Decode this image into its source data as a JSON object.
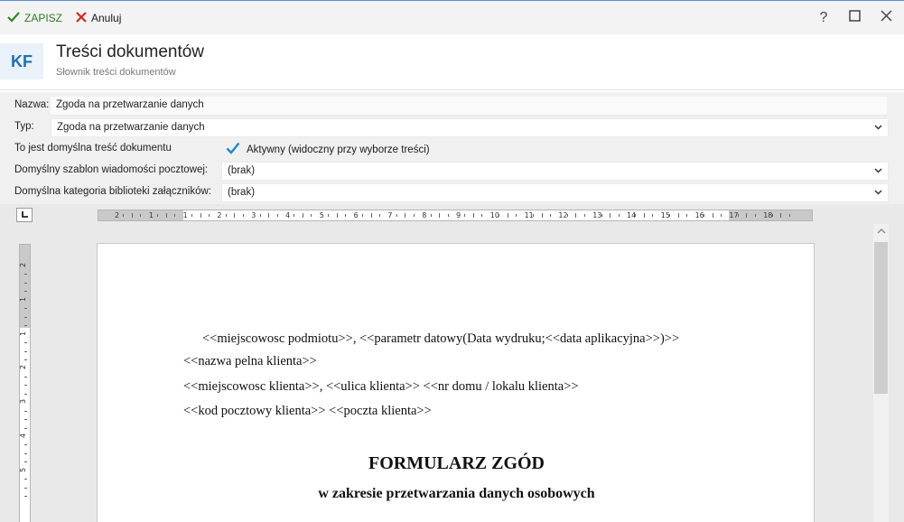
{
  "toolbar": {
    "save_label": "ZAPISZ",
    "cancel_label": "Anuluj",
    "help_label": "?",
    "accent_color": "#2e7d1f"
  },
  "header": {
    "logo": "KF",
    "title": "Treści dokumentów",
    "subtitle": "Słownik treści dokumentów"
  },
  "form": {
    "name_label": "Nazwa:",
    "name_value": "Zgoda na przetwarzanie danych",
    "type_label": "Typ:",
    "type_value": "Zgoda na przetwarzanie danych",
    "default_label": "To jest domyślna treść dokumentu",
    "active_label": "Aktywny (widoczny przy wyborze treści)",
    "active_checked": true,
    "mail_template_label": "Domyślny szablon wiadomości pocztowej:",
    "mail_template_value": "(brak)",
    "attachment_category_label": "Domyślna kategoria biblioteki załączników:",
    "attachment_category_value": "(brak)"
  },
  "ruler": {
    "horizontal_numbers": [
      "2",
      "1",
      "1",
      "2",
      "3",
      "4",
      "5",
      "6",
      "7",
      "8",
      "9",
      "10",
      "11",
      "12",
      "13",
      "14",
      "15",
      "16",
      "17",
      "18"
    ],
    "vertical_numbers": [
      "2",
      "1",
      "1",
      "2",
      "3",
      "4",
      "5"
    ]
  },
  "document": {
    "line1": "<<miejscowosc podmiotu>>, <<parametr datowy(Data wydruku;<<data aplikacyjna>>)>>",
    "line2": "<<nazwa pelna klienta>>",
    "line3": "<<miejscowosc klienta>>, <<ulica klienta>> <<nr domu / lokalu klienta>>",
    "line4": "<<kod pocztowy klienta>> <<poczta klienta>>",
    "heading": "FORMULARZ ZGÓD",
    "subheading": "w zakresie przetwarzania danych osobowych"
  }
}
